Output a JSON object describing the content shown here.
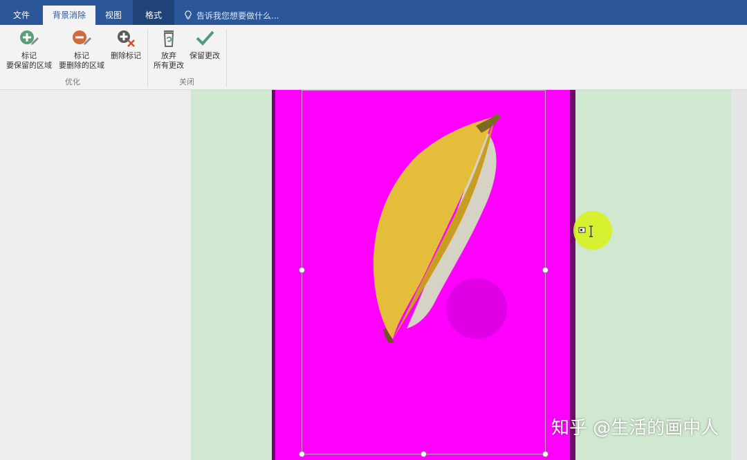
{
  "tabs": [
    {
      "label": "文件",
      "active": false
    },
    {
      "label": "背景消除",
      "active": true
    },
    {
      "label": "视图",
      "active": false
    },
    {
      "label": "格式",
      "active": false
    }
  ],
  "tellme": {
    "label": "告诉我您想要做什么..."
  },
  "ribbon": {
    "groups": [
      {
        "label": "优化",
        "buttons": [
          {
            "line1": "标记",
            "line2": "要保留的区域",
            "icon": "mark-keep-plus-icon"
          },
          {
            "line1": "标记",
            "line2": "要删除的区域",
            "icon": "mark-remove-minus-icon"
          },
          {
            "line1": "删除标记",
            "line2": "",
            "icon": "delete-mark-icon"
          }
        ]
      },
      {
        "label": "关闭",
        "buttons": [
          {
            "line1": "放弃",
            "line2": "所有更改",
            "icon": "discard-trash-icon"
          },
          {
            "line1": "保留更改",
            "line2": "",
            "icon": "keep-check-icon"
          }
        ]
      }
    ]
  },
  "colors": {
    "tabbar": "#2b579a",
    "removal_overlay": "#ff00ff",
    "page_background": "#cfe8cf",
    "cursor_highlight": "#d7f21f"
  },
  "watermark": {
    "text": "知乎 @生活的画中人"
  }
}
